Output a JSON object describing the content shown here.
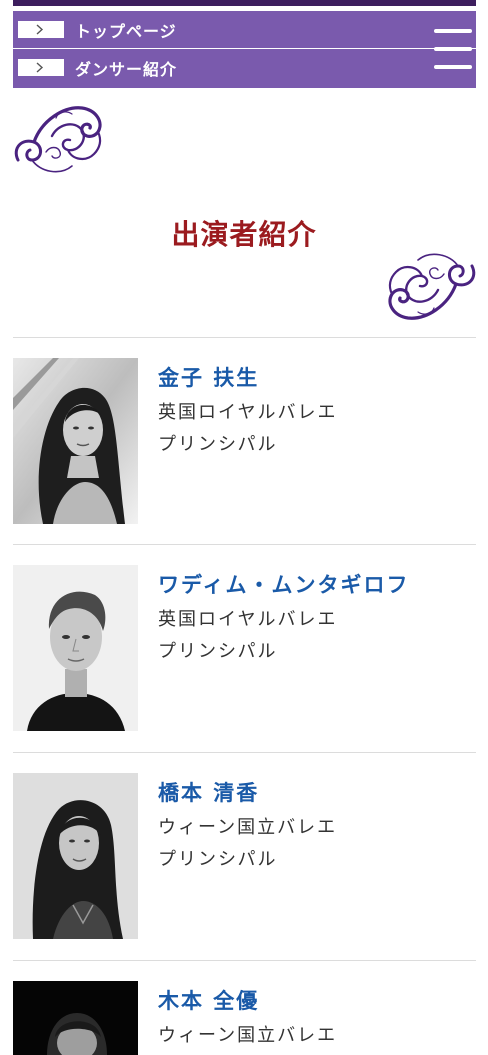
{
  "nav": {
    "items": [
      {
        "label": "トップページ"
      },
      {
        "label": "ダンサー紹介"
      }
    ]
  },
  "page": {
    "title": "出演者紹介"
  },
  "dancers": [
    {
      "name": "金子 扶生",
      "company": "英国ロイヤルバレエ",
      "rank": "プリンシパル"
    },
    {
      "name": "ワディム・ムンタギロフ",
      "company": "英国ロイヤルバレエ",
      "rank": "プリンシパル"
    },
    {
      "name": "橋本 清香",
      "company": "ウィーン国立バレエ",
      "rank": "プリンシパル"
    },
    {
      "name": "木本 全優",
      "company": "ウィーン国立バレエ",
      "rank": ""
    }
  ],
  "colors": {
    "nav_bg": "#7a5aad",
    "top_bar": "#3d1e5e",
    "title": "#9b1b1f",
    "dancer_name": "#1a5aa8",
    "flourish": "#4a2380"
  }
}
